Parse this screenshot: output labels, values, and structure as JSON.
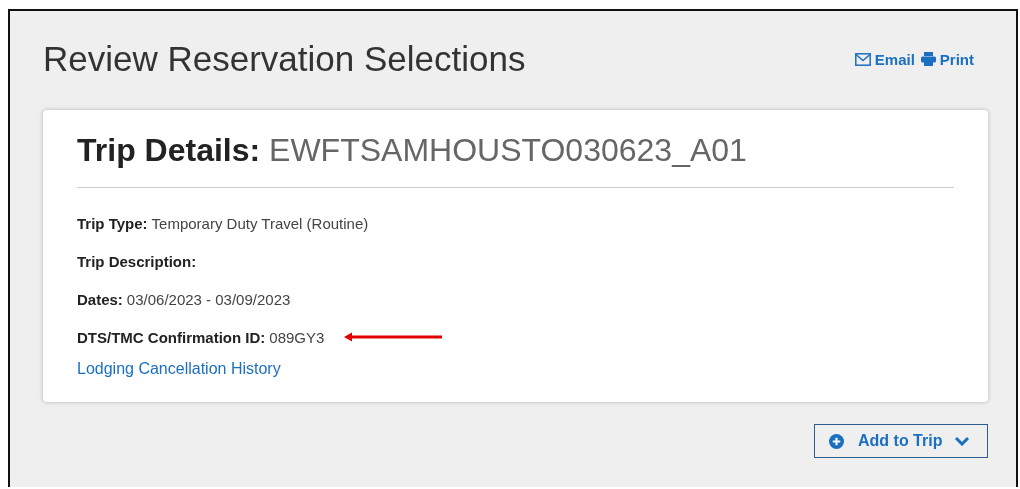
{
  "page": {
    "title": "Review Reservation Selections",
    "actions": [
      {
        "kind": "email",
        "label": "Email"
      },
      {
        "kind": "print",
        "label": "Print"
      }
    ]
  },
  "trip": {
    "heading_label": "Trip Details:",
    "heading_value": "EWFTSAMHOUSTO030623_A01",
    "fields": [
      {
        "label": "Trip Type:",
        "value": "Temporary Duty Travel (Routine)"
      },
      {
        "label": "Trip Description:"
      },
      {
        "label": "Dates:",
        "value": "03/06/2023 - 03/09/2023"
      },
      {
        "label": "DTS/TMC Confirmation ID:",
        "value": "089GY3",
        "marked": true
      }
    ],
    "link": "Lodging Cancellation History"
  },
  "add_button": {
    "label": "Add to Trip"
  }
}
